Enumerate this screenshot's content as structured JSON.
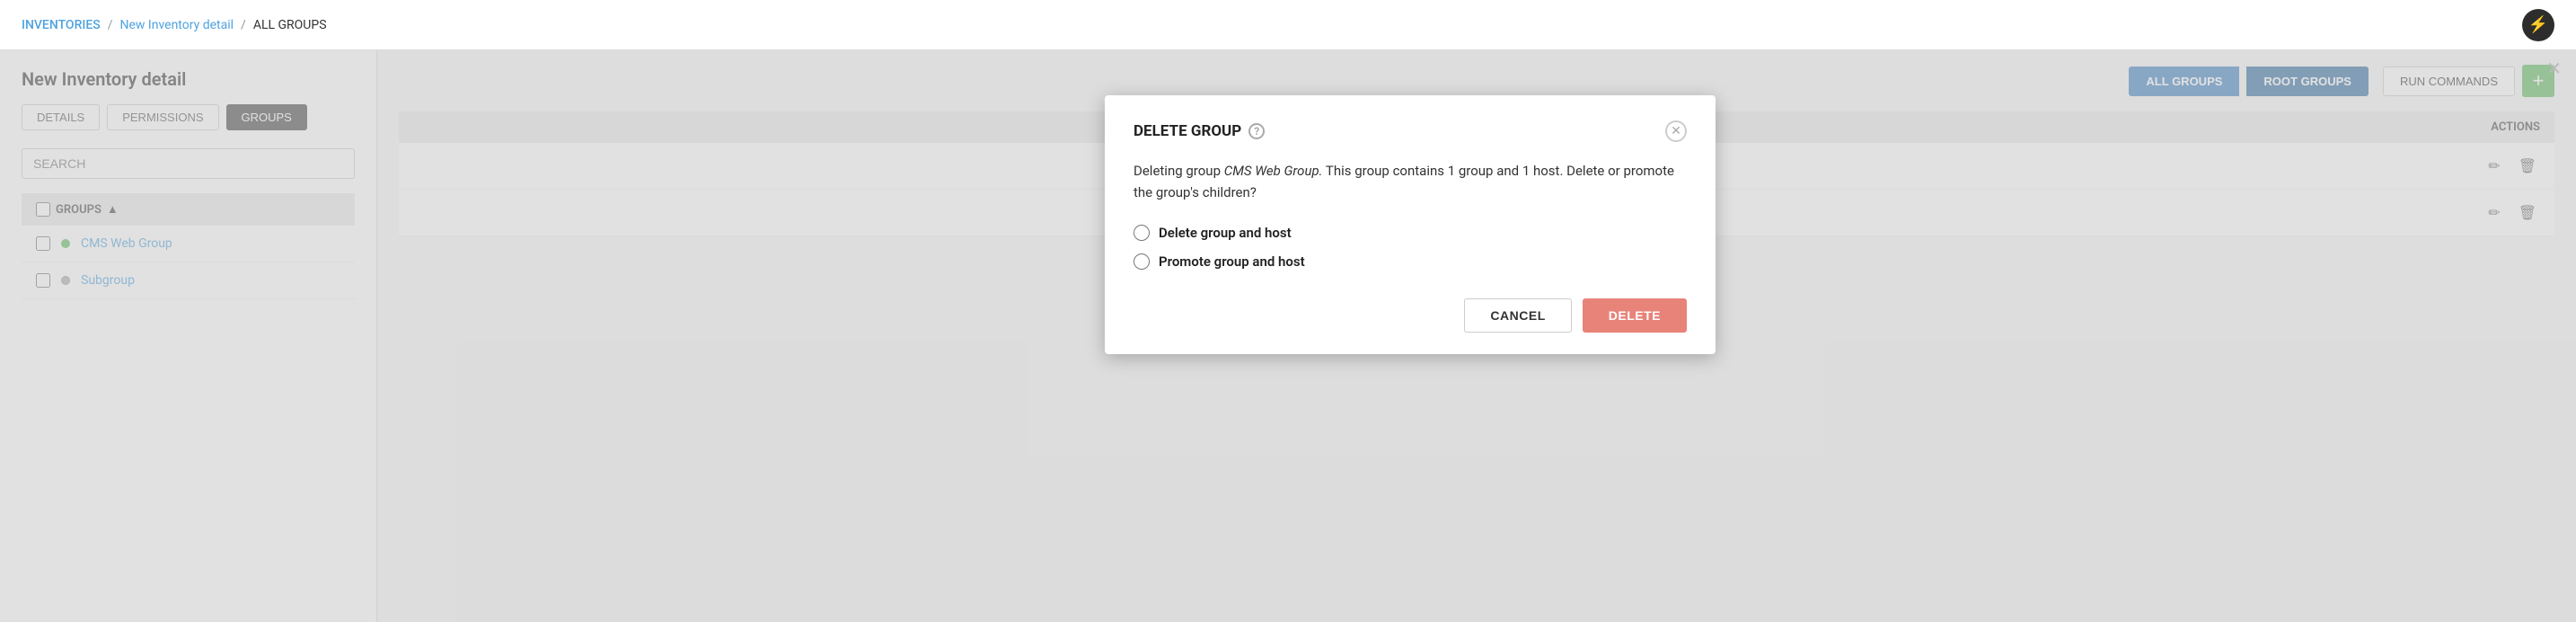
{
  "nav": {
    "inventories_label": "INVENTORIES",
    "sep1": "/",
    "new_inventory_label": "New Inventory detail",
    "sep2": "/",
    "all_groups_label": "ALL GROUPS",
    "logo_symbol": "⚡"
  },
  "left_panel": {
    "title": "New Inventory detail",
    "tabs": [
      {
        "label": "DETAILS",
        "active": false
      },
      {
        "label": "PERMISSIONS",
        "active": false
      },
      {
        "label": "GROUPS",
        "active": true
      }
    ],
    "search_placeholder": "SEARCH",
    "groups_col_label": "GROUPS",
    "sort_indicator": "▲",
    "rows": [
      {
        "name": "CMS Web Group",
        "status": "green"
      },
      {
        "name": "Subgroup",
        "status": "gray"
      }
    ]
  },
  "right_panel": {
    "all_groups_btn": "ALL GROUPS",
    "root_groups_btn": "ROOT GROUPS",
    "run_commands_btn": "RUN COMMANDS",
    "add_btn": "+",
    "actions_col_label": "ACTIONS",
    "close_symbol": "✕"
  },
  "modal": {
    "title": "DELETE GROUP",
    "help_icon": "?",
    "close_icon": "✕",
    "body_text_1": "Deleting group ",
    "body_italic": "CMS Web Group.",
    "body_text_2": " This group contains 1 group and 1 host. Delete or promote the group's children?",
    "radio_options": [
      {
        "id": "delete-opt",
        "label": "Delete group and host",
        "checked": false
      },
      {
        "id": "promote-opt",
        "label": "Promote group and host",
        "checked": false
      }
    ],
    "cancel_btn": "CANCEL",
    "delete_btn": "DELETE"
  }
}
